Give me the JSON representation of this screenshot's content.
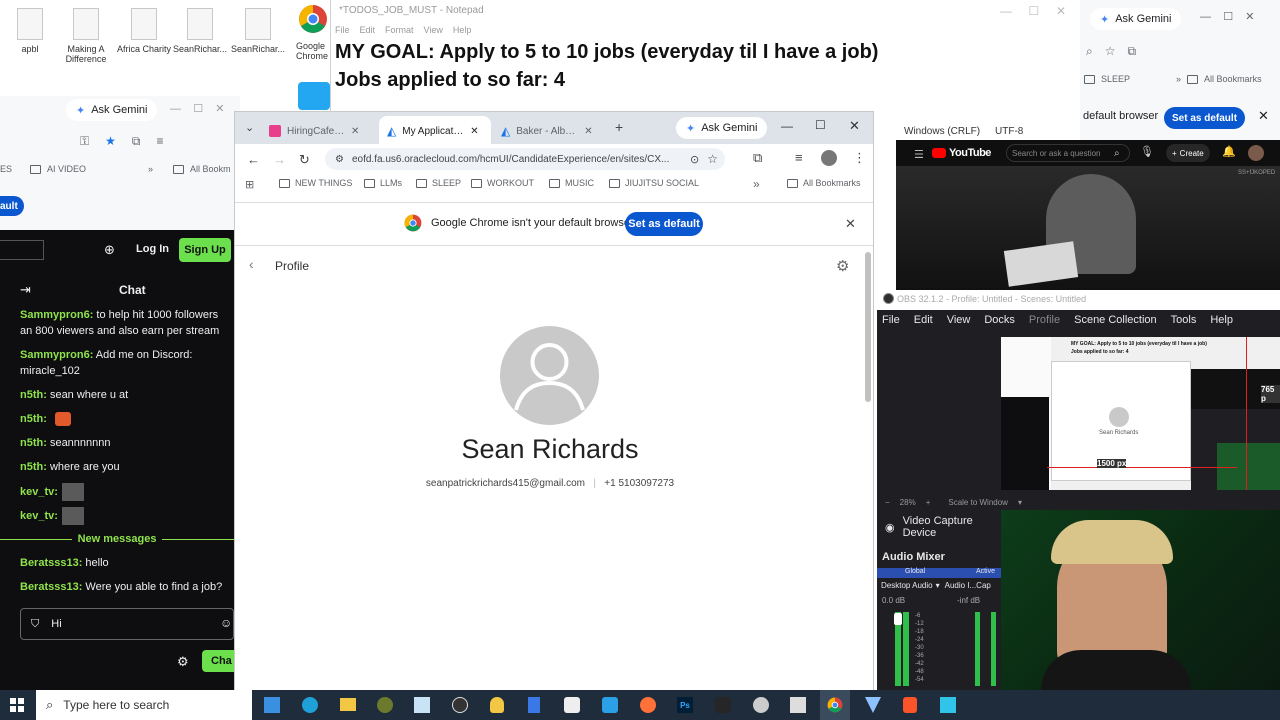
{
  "desktop_icons": [
    {
      "label": "apbl"
    },
    {
      "label": "Making A Difference"
    },
    {
      "label": "Africa Charity"
    },
    {
      "label": "SeanRichar..."
    },
    {
      "label": "SeanRichar..."
    }
  ],
  "desktop_chrome_label": "Google Chrome",
  "notepad": {
    "title": "*TODOS_JOB_MUST - Notepad",
    "menu": [
      "File",
      "Edit",
      "Format",
      "View",
      "Help"
    ],
    "lines": [
      "MY GOAL: Apply to 5 to 10 jobs (everyday til I have a job)",
      "Jobs applied to so far: 4"
    ],
    "status_eol": "Windows (CRLF)",
    "status_enc": "UTF-8"
  },
  "left_chrome": {
    "ask_gemini": "Ask Gemini",
    "bookmark_ai_video": "AI VIDEO",
    "bookmark_all": "All Bookm",
    "bookmark_es": "ES",
    "default_btn": "ault"
  },
  "chat": {
    "login": "Log In",
    "signup": "Sign Up",
    "header": "Chat",
    "new_messages": "New messages",
    "input_value": "Hi",
    "send_label": "Cha",
    "messages": [
      {
        "user": "Sammypron6:",
        "text": " to help hit 1000 followers an 800 viewers and also earn per stream"
      },
      {
        "user": "Sammypron6:",
        "text": " Add me on Discord: miracle_102"
      },
      {
        "user": "n5th:",
        "text": " sean where u at"
      },
      {
        "user": "n5th:",
        "text": ""
      },
      {
        "user": "n5th:",
        "text": " seannnnnnn"
      },
      {
        "user": "n5th:",
        "text": " where are you"
      },
      {
        "user": "kev_tv:",
        "text": ""
      },
      {
        "user": "kev_tv:",
        "text": ""
      },
      {
        "user": "Beratsss13:",
        "text": " hello"
      },
      {
        "user": "Beratsss13:",
        "text": " Were you able to find a job?"
      }
    ]
  },
  "main_chrome": {
    "tabs": [
      "HiringCafe - AI",
      "My Application",
      "Baker - Alberts"
    ],
    "ask_gemini": "Ask Gemini",
    "url": "eofd.fa.us6.oraclecloud.com/hcmUI/CandidateExperience/en/sites/CX...",
    "bookmarks": [
      "NEW THINGS",
      "LLMs",
      "SLEEP",
      "WORKOUT",
      "MUSIC",
      "JIUJITSU SOCIAL"
    ],
    "all_bookmarks": "All Bookmarks",
    "banner_text": "Google Chrome isn't your default browser",
    "banner_btn": "Set as default",
    "profile_label": "Profile",
    "name": "Sean Richards",
    "email": "seanpatrickrichards415@gmail.com",
    "separator": "|",
    "phone": "+1 5103097273"
  },
  "right_chrome": {
    "ask_gemini": "Ask Gemini",
    "bookmark_sleep": "SLEEP",
    "all_bookmarks": "All Bookmarks",
    "banner_text": "default browser",
    "banner_btn": "Set as default"
  },
  "youtube": {
    "logo": "YouTube",
    "search_placeholder": "Search or ask a question",
    "create": "Create",
    "video_overlay": "SS+fJKOPED"
  },
  "obs": {
    "title": "OBS 32.1.2 - Profile: Untitled - Scenes: Untitled",
    "menu": [
      "File",
      "Edit",
      "View",
      "Docks",
      "Profile",
      "Scene Collection",
      "Tools",
      "Help"
    ],
    "preview_text_1": "MY GOAL: Apply to 5 to 10 jobs (everyday til I have a job)",
    "preview_text_2": "Jobs applied to so far: 4",
    "preview_name": "Sean Richards",
    "preview_measure": "1500 px",
    "preview_measure_2": "765 p",
    "zoom": "28%",
    "scale_label": "Scale to Window",
    "source": "Video Capture Device",
    "audio_mixer": "Audio Mixer",
    "global": "Global",
    "active": "Active",
    "desktop_audio": "Desktop Audio",
    "audio_2": "Audio I...Cap",
    "db_value": "0.0 dB",
    "db_value_2": "-inf dB",
    "scale": [
      "-6",
      "-12",
      "-18",
      "-24",
      "-30",
      "-36",
      "-42",
      "-48",
      "-54"
    ]
  },
  "taskbar": {
    "search_placeholder": "Type here to search"
  }
}
